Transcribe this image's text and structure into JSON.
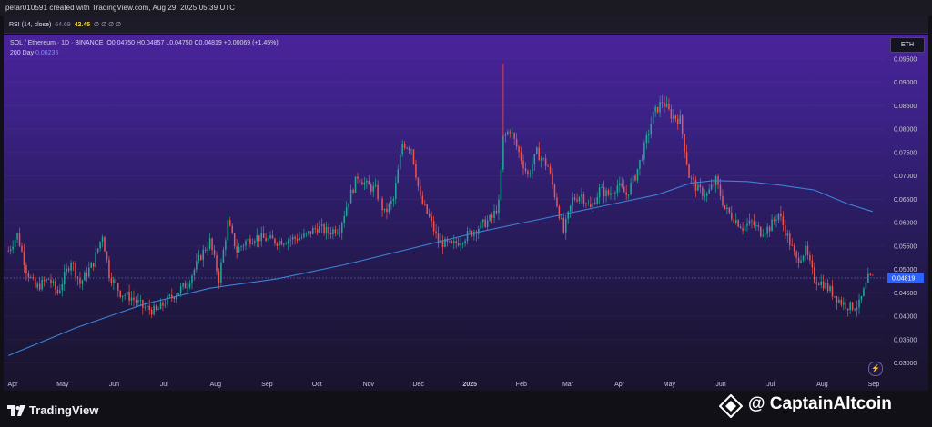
{
  "header": {
    "title": "petar010591 created with TradingView.com, Aug 29, 2025 05:39 UTC"
  },
  "rsi": {
    "label": "RSI (14, close)",
    "value1": "64.69",
    "value2": "42.45",
    "placeholders": "∅ ∅ ∅ ∅"
  },
  "legend": {
    "symbol": "SOL / Ethereum · 1D · BINANCE",
    "ohlc": "O0.04750 H0.04857 L0.04750 C0.04819 +0.00069 (+1.45%)",
    "ma_label": "200 Day",
    "ma_value": "0.06235"
  },
  "currency_button": "ETH",
  "price_tag": "0.04819",
  "colors": {
    "up": "#26a69a",
    "down": "#ef5350",
    "ma": "#3b82d6",
    "tag": "#2962ff"
  },
  "icons": {
    "indicator": "lightning-icon",
    "logo": "tradingview-logo-icon",
    "brand": "captainaltcoin-diamond-icon"
  },
  "chart_data": {
    "type": "candlestick",
    "title": "SOL / Ethereum · 1D · BINANCE",
    "x_ticks": [
      "Apr",
      "May",
      "Jun",
      "Jul",
      "Aug",
      "Sep",
      "Oct",
      "Nov",
      "Dec",
      "2025",
      "Feb",
      "Mar",
      "Apr",
      "May",
      "Jun",
      "Jul",
      "Aug",
      "Sep"
    ],
    "y_ticks": [
      "0.09500",
      "0.09000",
      "0.08500",
      "0.08000",
      "0.07500",
      "0.07000",
      "0.06500",
      "0.06000",
      "0.05500",
      "0.05000",
      "0.04500",
      "0.04000",
      "0.03500",
      "0.03000"
    ],
    "ylim": [
      0.0276,
      0.0975
    ],
    "price_anchors": [
      [
        0,
        0.054
      ],
      [
        4,
        0.0575
      ],
      [
        8,
        0.05
      ],
      [
        12,
        0.046
      ],
      [
        18,
        0.048
      ],
      [
        22,
        0.045
      ],
      [
        28,
        0.052
      ],
      [
        32,
        0.047
      ],
      [
        38,
        0.0515
      ],
      [
        42,
        0.0575
      ],
      [
        45,
        0.049
      ],
      [
        50,
        0.045
      ],
      [
        55,
        0.044
      ],
      [
        60,
        0.042
      ],
      [
        66,
        0.041
      ],
      [
        70,
        0.043
      ],
      [
        75,
        0.045
      ],
      [
        80,
        0.047
      ],
      [
        86,
        0.053
      ],
      [
        90,
        0.056
      ],
      [
        94,
        0.048
      ],
      [
        98,
        0.06
      ],
      [
        102,
        0.054
      ],
      [
        106,
        0.056
      ],
      [
        110,
        0.057
      ],
      [
        115,
        0.0565
      ],
      [
        120,
        0.056
      ],
      [
        126,
        0.0565
      ],
      [
        132,
        0.057
      ],
      [
        138,
        0.059
      ],
      [
        143,
        0.058
      ],
      [
        148,
        0.059
      ],
      [
        152,
        0.065
      ],
      [
        156,
        0.07
      ],
      [
        160,
        0.068
      ],
      [
        164,
        0.067
      ],
      [
        168,
        0.062
      ],
      [
        172,
        0.065
      ],
      [
        176,
        0.077
      ],
      [
        180,
        0.076
      ],
      [
        184,
        0.065
      ],
      [
        188,
        0.061
      ],
      [
        192,
        0.056
      ],
      [
        198,
        0.055
      ],
      [
        204,
        0.057
      ],
      [
        210,
        0.059
      ],
      [
        216,
        0.061
      ],
      [
        219,
        0.064
      ],
      [
        221,
        0.078
      ],
      [
        224,
        0.08
      ],
      [
        228,
        0.075
      ],
      [
        232,
        0.07
      ],
      [
        236,
        0.075
      ],
      [
        241,
        0.072
      ],
      [
        245,
        0.064
      ],
      [
        248,
        0.058
      ],
      [
        252,
        0.065
      ],
      [
        256,
        0.066
      ],
      [
        260,
        0.063
      ],
      [
        264,
        0.067
      ],
      [
        268,
        0.066
      ],
      [
        272,
        0.068
      ],
      [
        276,
        0.066
      ],
      [
        280,
        0.07
      ],
      [
        284,
        0.076
      ],
      [
        288,
        0.083
      ],
      [
        292,
        0.086
      ],
      [
        296,
        0.083
      ],
      [
        300,
        0.082
      ],
      [
        304,
        0.07
      ],
      [
        308,
        0.067
      ],
      [
        312,
        0.066
      ],
      [
        316,
        0.069
      ],
      [
        320,
        0.063
      ],
      [
        324,
        0.061
      ],
      [
        328,
        0.059
      ],
      [
        332,
        0.06
      ],
      [
        336,
        0.058
      ],
      [
        340,
        0.059
      ],
      [
        344,
        0.062
      ],
      [
        348,
        0.057
      ],
      [
        352,
        0.052
      ],
      [
        356,
        0.054
      ],
      [
        360,
        0.048
      ],
      [
        364,
        0.047
      ],
      [
        368,
        0.045
      ],
      [
        372,
        0.043
      ],
      [
        376,
        0.042
      ],
      [
        380,
        0.0425
      ],
      [
        384,
        0.048
      ],
      [
        386,
        0.0482
      ]
    ],
    "ma_series": {
      "name": "200 Day",
      "points": [
        [
          0,
          0.0316
        ],
        [
          30,
          0.0375
        ],
        [
          60,
          0.0425
        ],
        [
          90,
          0.046
        ],
        [
          120,
          0.048
        ],
        [
          150,
          0.051
        ],
        [
          180,
          0.0545
        ],
        [
          210,
          0.058
        ],
        [
          240,
          0.061
        ],
        [
          270,
          0.064
        ],
        [
          290,
          0.066
        ],
        [
          305,
          0.0685
        ],
        [
          315,
          0.069
        ],
        [
          330,
          0.0688
        ],
        [
          345,
          0.068
        ],
        [
          360,
          0.067
        ],
        [
          375,
          0.064
        ],
        [
          386,
          0.0624
        ]
      ]
    },
    "last_price": 0.04819
  }
}
